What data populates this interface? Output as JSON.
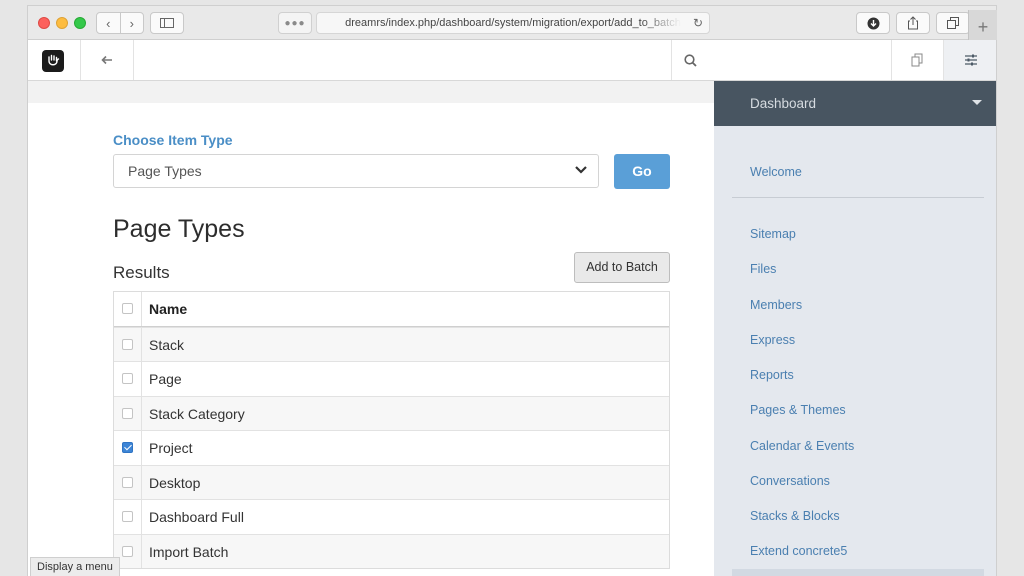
{
  "browser": {
    "url": "dreamrs/index.php/dashboard/system/migration/export/add_to_batch",
    "new_tab_label": "+"
  },
  "toolbar": {
    "logo_icon": "concrete5-hand-logo",
    "back_icon": "arrow-left-icon",
    "search_icon": "search-icon",
    "pages_icon": "pages-icon",
    "settings_icon": "sliders-icon"
  },
  "main": {
    "choose_label": "Choose Item Type",
    "select_value": "Page Types",
    "go_label": "Go",
    "page_title": "Page Types",
    "results_label": "Results",
    "add_to_batch_label": "Add to Batch",
    "table": {
      "header": "Name",
      "rows": [
        {
          "name": "Stack",
          "checked": false
        },
        {
          "name": "Page",
          "checked": false
        },
        {
          "name": "Stack Category",
          "checked": false
        },
        {
          "name": "Project",
          "checked": true
        },
        {
          "name": "Desktop",
          "checked": false
        },
        {
          "name": "Dashboard Full",
          "checked": false
        },
        {
          "name": "Import Batch",
          "checked": false
        }
      ]
    }
  },
  "dashboard": {
    "title": "Dashboard",
    "items": [
      "Welcome",
      "Sitemap",
      "Files",
      "Members",
      "Express",
      "Reports",
      "Pages & Themes",
      "Calendar & Events",
      "Conversations",
      "Stacks & Blocks",
      "Extend concrete5"
    ]
  },
  "status_tooltip": "Display a menu",
  "colors": {
    "accent": "#4a8ec6",
    "go_button": "#5a9fd7",
    "dashboard_header": "#485561",
    "dashboard_bg": "#e4e8ee"
  }
}
